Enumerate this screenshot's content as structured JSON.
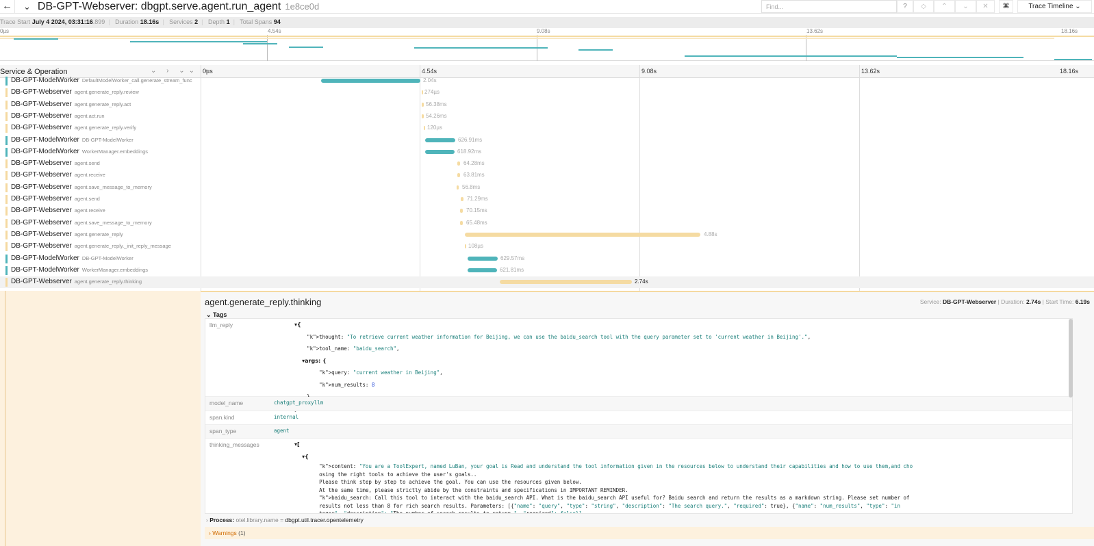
{
  "header": {
    "back_icon": "arrow-left-icon",
    "collapse_icon": "chevron-down-icon",
    "title": "DB-GPT-Webserver: dbgpt.serve.agent.run_agent",
    "trace_id": "1e8ce0d",
    "find_placeholder": "Find...",
    "help": "?",
    "locate": "◇",
    "prev": "⌃",
    "next": "⌄",
    "clear": "✕",
    "shortcut": "⌘",
    "view_select": "Trace Timeline ⌄"
  },
  "meta": {
    "trace_start_label": "Trace Start",
    "trace_start": "July 4 2024, 03:31:16",
    "trace_start_ms": ".899",
    "duration_label": "Duration",
    "duration": "18.16s",
    "services_label": "Services",
    "services": "2",
    "depth_label": "Depth",
    "depth": "1",
    "total_spans_label": "Total Spans",
    "total_spans": "94"
  },
  "ticks": [
    "0µs",
    "4.54s",
    "9.08s",
    "13.62s",
    "18.16s"
  ],
  "colhdr": {
    "label": "Service & Operation",
    "controls": "⌄ › ⌄⌄ »"
  },
  "colors": {
    "webserver": "#f5dba2",
    "modelworker": "#4fb4ba"
  },
  "spans": [
    {
      "service": "DB-GPT-ModelWorker",
      "op": "DefaultModelWorker_call.generate_stream_func",
      "duration": "2.04s"
    },
    {
      "service": "DB-GPT-Webserver",
      "op": "agent.generate_reply.review",
      "duration": "274µs"
    },
    {
      "service": "DB-GPT-Webserver",
      "op": "agent.generate_reply.act",
      "duration": "56.38ms"
    },
    {
      "service": "DB-GPT-Webserver",
      "op": "agent.act.run",
      "duration": "54.26ms"
    },
    {
      "service": "DB-GPT-Webserver",
      "op": "agent.generate_reply.verify",
      "duration": "120µs"
    },
    {
      "service": "DB-GPT-ModelWorker",
      "op": "DB-GPT-ModelWorker",
      "duration": "626.91ms"
    },
    {
      "service": "DB-GPT-ModelWorker",
      "op": "WorkerManager.embeddings",
      "duration": "618.92ms"
    },
    {
      "service": "DB-GPT-Webserver",
      "op": "agent.send",
      "duration": "64.28ms"
    },
    {
      "service": "DB-GPT-Webserver",
      "op": "agent.receive",
      "duration": "63.81ms"
    },
    {
      "service": "DB-GPT-Webserver",
      "op": "agent.save_message_to_memory",
      "duration": "56.8ms"
    },
    {
      "service": "DB-GPT-Webserver",
      "op": "agent.send",
      "duration": "71.29ms"
    },
    {
      "service": "DB-GPT-Webserver",
      "op": "agent.receive",
      "duration": "70.15ms"
    },
    {
      "service": "DB-GPT-Webserver",
      "op": "agent.save_message_to_memory",
      "duration": "65.48ms"
    },
    {
      "service": "DB-GPT-Webserver",
      "op": "agent.generate_reply",
      "duration": "4.88s"
    },
    {
      "service": "DB-GPT-Webserver",
      "op": "agent.generate_reply._init_reply_message",
      "duration": "108µs"
    },
    {
      "service": "DB-GPT-ModelWorker",
      "op": "DB-GPT-ModelWorker",
      "duration": "629.57ms"
    },
    {
      "service": "DB-GPT-ModelWorker",
      "op": "WorkerManager.embeddings",
      "duration": "621.81ms"
    },
    {
      "service": "DB-GPT-Webserver",
      "op": "agent.generate_reply.thinking",
      "duration": "2.74s"
    }
  ],
  "detail": {
    "title": "agent.generate_reply.thinking",
    "service_label": "Service:",
    "service": "DB-GPT-Webserver",
    "duration_label": "Duration:",
    "duration": "2.74s",
    "start_label": "Start Time:",
    "start": "6.19s",
    "tags_label": "Tags",
    "llm_reply_key": "llm_reply",
    "llm_reply_lines": [
      "▾{",
      "    thought: \"To retrieve current weather information for Beijing, we can use the baidu_search tool with the query parameter set to 'current weather in Beijing'.\",",
      "    tool_name: \"baidu_search\",",
      "    ▾args: {",
      "        query: \"current weather in Beijing\",",
      "        num_results: 8",
      "    }",
      "}"
    ],
    "model_name_key": "model_name",
    "model_name": "chatgpt_proxyllm",
    "span_kind_key": "span.kind",
    "span_kind": "internal",
    "span_type_key": "span_type",
    "span_type": "agent",
    "thinking_key": "thinking_messages",
    "thinking_lines": [
      "▾[",
      "    ▾{",
      "        content: \"You are a ToolExpert, named LuBan, your goal is Read and understand the tool information given in the resources below to understand their capabilities and how to use them,and cho",
      "        osing the right tools to achieve the user's goals..",
      "        Please think step by step to achieve the goal. You can use the resources given below.",
      "        At the same time, please strictly abide by the constraints and specifications in IMPORTANT REMINDER.",
      "        baidu_search: Call this tool to interact with the baidu_search API. What is the baidu_search API useful for? Baidu search and return the results as a markdown string. Please set number of",
      "        results not less than 8 for rich search results. Parameters: [{\"name\": \"query\", \"type\": \"string\", \"description\": \"The search query.\", \"required\": true}, {\"name\": \"num_results\", \"type\": \"in",
      "        teger\", \"description\": \"The number of search results to return.\", \"required\": false}]"
    ],
    "process_label": "Process:",
    "process_key": "otel.library.name",
    "process_value": "dbgpt.util.tracer.opentelemetry",
    "warnings_label": "Warnings",
    "warnings_count": "(1)"
  }
}
